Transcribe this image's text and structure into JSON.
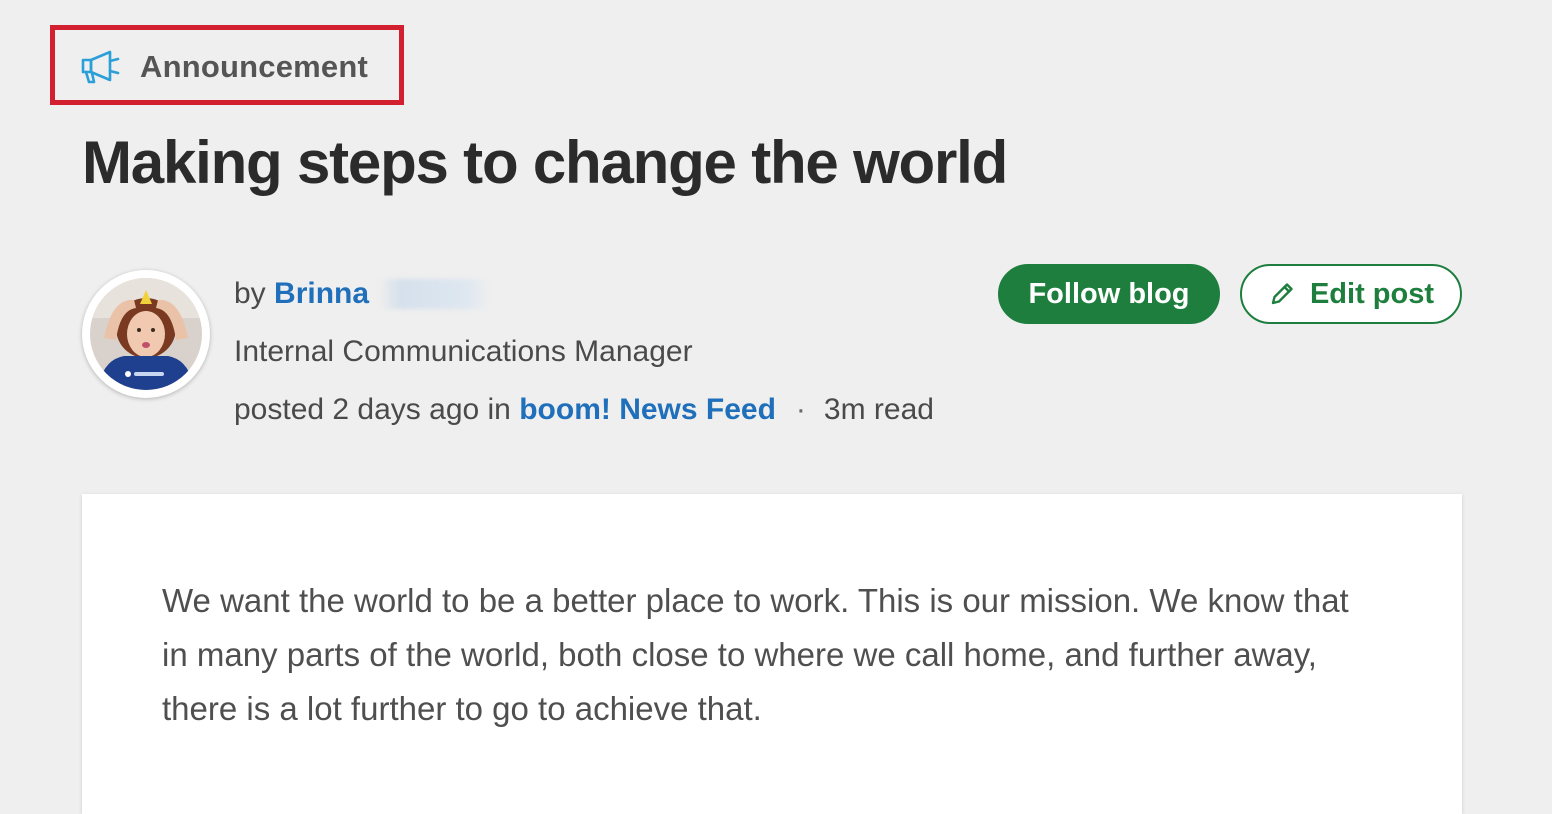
{
  "post": {
    "tag": {
      "icon": "megaphone-icon",
      "label": "Announcement",
      "icon_color": "#2a9fd8",
      "highlight_color": "#d32030"
    },
    "title": "Making steps to change the world",
    "author": {
      "by_prefix": "by",
      "name": "Brinna",
      "role": "Internal Communications Manager",
      "avatar": "author-avatar"
    },
    "posted": {
      "prefix": "posted 2 days ago in",
      "feed_link": "boom! News Feed",
      "separator": "·",
      "read_time": "3m read"
    },
    "actions": {
      "follow_label": "Follow blog",
      "edit_label": "Edit post",
      "edit_icon": "pencil-icon",
      "accent_color": "#1e7e3e"
    },
    "body": "We want the world to be a better place to work. This is our mission. We know that in many parts of the world, both close to where we call home, and further away, there is a lot further to go to achieve that."
  }
}
